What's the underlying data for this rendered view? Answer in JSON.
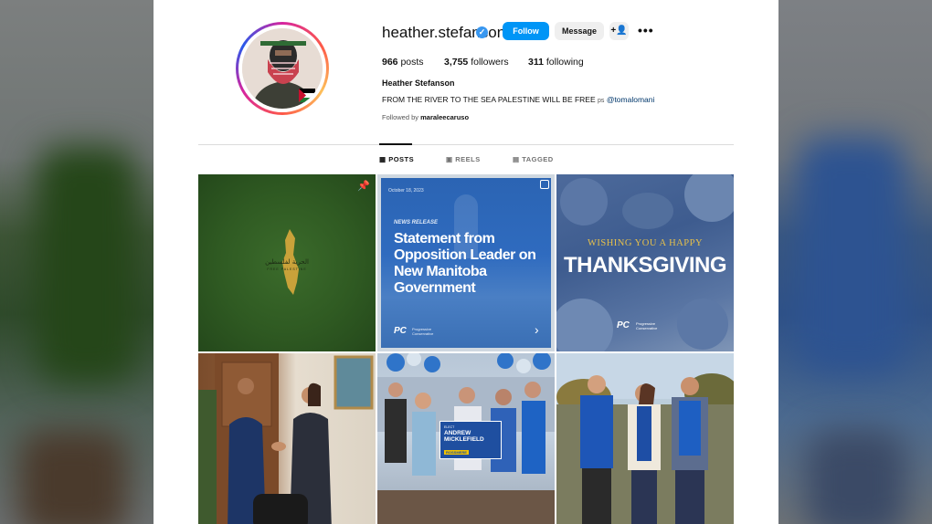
{
  "profile": {
    "username": "heather.stefanson",
    "verified_icon": "verified-badge-icon",
    "follow_label": "Follow",
    "message_label": "Message",
    "add_user_icon": "+👤",
    "more_icon": "•••",
    "posts_count": "966",
    "posts_label": "posts",
    "followers_count": "3,755",
    "followers_label": "followers",
    "following_count": "311",
    "following_label": "following",
    "full_name": "Heather Stefanson",
    "bio_text": "FROM THE RIVER TO THE SEA PALESTINE WILL BE FREE",
    "bio_ps": "ps",
    "bio_mention": "@tomalomani",
    "followed_by_prefix": "Followed by ",
    "followed_by_user": "maraleecaruso"
  },
  "tabs": [
    {
      "label": "POSTS",
      "icon": "grid-icon",
      "glyph": "▦"
    },
    {
      "label": "REELS",
      "icon": "reels-icon",
      "glyph": "▣"
    },
    {
      "label": "TAGGED",
      "icon": "tagged-icon",
      "glyph": "▤"
    }
  ],
  "posts": [
    {
      "caption": "الحرية لفلسطين",
      "sub": "FREE PALESTINE"
    },
    {
      "date": "October 18, 2023",
      "kicker": "NEWS RELEASE",
      "headline": "Statement from Opposition Leader on New Manitoba Government",
      "logo": "PC",
      "logo_sub": "Progressive Conservative"
    },
    {
      "line1": "WISHING YOU A HAPPY",
      "line2": "THANKSGIVING",
      "logo": "PC",
      "logo_sub": "Progressive Conservative"
    },
    {},
    {
      "sign_small": "ELECT",
      "sign_name": "ANDREW MICKLEFIELD",
      "sign_area": "ROSSMERE"
    },
    {}
  ],
  "colors": {
    "follow_button": "#0095f6",
    "verified": "#3897f0",
    "pc_blue": "#1f5fae"
  }
}
